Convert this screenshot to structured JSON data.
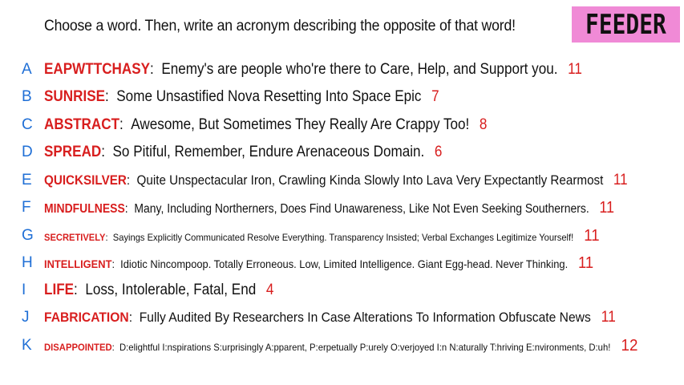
{
  "header": {
    "prompt": "Choose a word. Then, write an acronym describing the opposite of that word!",
    "brand": "FEEDER"
  },
  "entries": [
    {
      "letter": "A",
      "word": "EAPWTTCHASY",
      "definition": "Enemy's are people who're there to Care, Help, and Support you.",
      "count": "11"
    },
    {
      "letter": "B",
      "word": "SUNRISE",
      "definition": "Some Unsastified Nova Resetting Into Space Epic",
      "count": "7"
    },
    {
      "letter": "C",
      "word": "ABSTRACT",
      "definition": "Awesome, But Sometimes They Really Are Crappy Too!",
      "count": "8"
    },
    {
      "letter": "D",
      "word": "SPREAD",
      "definition": "So Pitiful, Remember, Endure Arenaceous Domain.",
      "count": "6"
    },
    {
      "letter": "E",
      "word": "QUICKSILVER",
      "definition": "Quite Unspectacular Iron, Crawling Kinda Slowly Into Lava Very Expectantly Rearmost",
      "count": "11"
    },
    {
      "letter": "F",
      "word": "MINDFULNESS",
      "definition": "Many, Including Northerners, Does Find Unawareness, Like Not Even Seeking Southerners.",
      "count": "11"
    },
    {
      "letter": "G",
      "word": "SECRETIVELY",
      "definition": "Sayings Explicitly Communicated Resolve Everything. Transparency Insisted; Verbal Exchanges Legitimize Yourself!",
      "count": "11"
    },
    {
      "letter": "H",
      "word": "INTELLIGENT",
      "definition": "Idiotic Nincompoop. Totally Erroneous. Low, Limited Intelligence. Giant Egg-head. Never Thinking.",
      "count": "11"
    },
    {
      "letter": "I",
      "word": "LIFE",
      "definition": "Loss, Intolerable, Fatal, End",
      "count": "4"
    },
    {
      "letter": "J",
      "word": "FABRICATION",
      "definition": "Fully Audited By Researchers In Case Alterations To Information Obfuscate News",
      "count": "11"
    },
    {
      "letter": "K",
      "word": "DISAPPOINTED",
      "definition": "D:elightful I:nspirations S:urprisingly A:pparent, P:erpetually P:urely O:verjoyed I:n N:aturally T:hriving E:nvironments, D:uh!",
      "count": "12"
    }
  ]
}
